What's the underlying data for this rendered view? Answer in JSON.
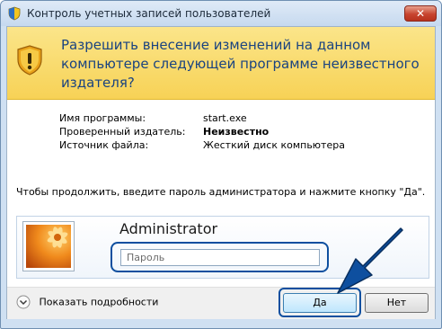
{
  "window": {
    "title": "Контроль учетных записей пользователей",
    "close_label": "✕"
  },
  "warning": {
    "headline": "Разрешить внесение изменений на данном компьютере следующей программе неизвестного издателя?"
  },
  "details": [
    {
      "label": "Имя программы:",
      "value": "start.exe"
    },
    {
      "label": "Проверенный издатель:",
      "value": "Неизвестно"
    },
    {
      "label": "Источник файла:",
      "value": "Жесткий диск компьютера"
    }
  ],
  "instruction": "Чтобы продолжить, введите пароль администратора и нажмите кнопку \"Да\".",
  "credentials": {
    "username": "Administrator",
    "password_placeholder": "Пароль"
  },
  "footer": {
    "show_details": "Показать подробности",
    "yes": "Да",
    "no": "Нет"
  },
  "colors": {
    "warning_band": "#f7d256",
    "highlight": "#0e4f9f",
    "headline_text": "#1a4380"
  },
  "icons": {
    "title": "shield-icon",
    "warning": "warning-shield-icon",
    "toggle": "chevron-down-icon",
    "pointer": "arrow-pointer-icon"
  }
}
